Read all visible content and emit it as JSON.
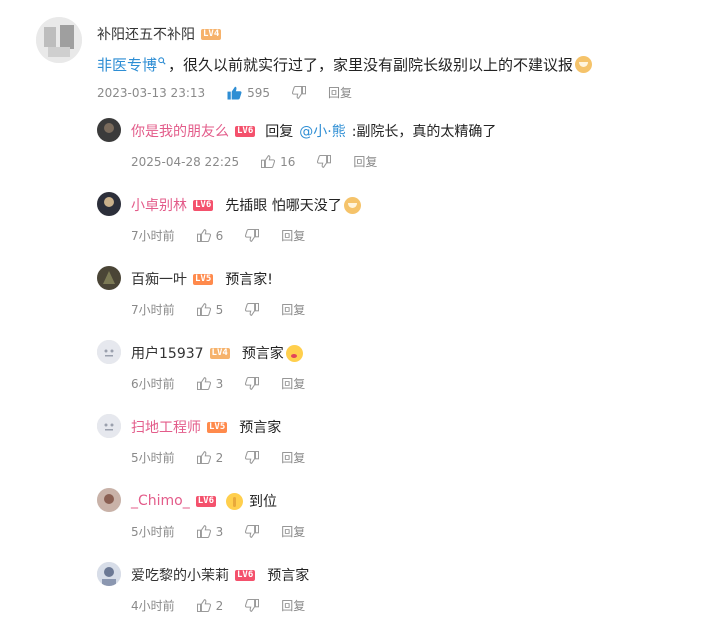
{
  "main": {
    "username": "补阳还五不补阳",
    "level": "LV4",
    "topic_link": "非医专博",
    "text": "，很久以前就实行过了，家里没有副院长级别以上的不建议报",
    "timestamp": "2023-03-13 23:13",
    "likes": "595",
    "reply_label": "回复"
  },
  "replies": [
    {
      "username": "你是我的朋友么",
      "level": "LV6",
      "prefix": "回复 ",
      "mention": "@小·熊",
      "text": ":副院长，真的太精确了",
      "timestamp": "2025-04-28 22:25",
      "likes": "16",
      "reply_label": "回复"
    },
    {
      "username": "小卓别林",
      "level": "LV6",
      "text": "先插眼 怕哪天没了",
      "timestamp": "7小时前",
      "likes": "6",
      "reply_label": "回复"
    },
    {
      "username": "百痴一叶",
      "level": "LV5",
      "text": "预言家!",
      "timestamp": "7小时前",
      "likes": "5",
      "reply_label": "回复"
    },
    {
      "username": "用户15937",
      "level": "LV4",
      "text": "预言家",
      "timestamp": "6小时前",
      "likes": "3",
      "reply_label": "回复"
    },
    {
      "username": "扫地工程师",
      "level": "LV5",
      "text": "预言家",
      "timestamp": "5小时前",
      "likes": "2",
      "reply_label": "回复"
    },
    {
      "username": "_Chimo_",
      "level": "LV6",
      "text": "到位",
      "timestamp": "5小时前",
      "likes": "3",
      "reply_label": "回复"
    },
    {
      "username": "爱吃黎的小茉莉",
      "level": "LV6",
      "text": "预言家",
      "timestamp": "4小时前",
      "likes": "2",
      "reply_label": "回复"
    }
  ],
  "colors": {
    "link": "#2e8ed4",
    "pink_username": "#e35c8a",
    "like_active": "#2e8ed4",
    "meta_gray": "#8a8a8a"
  },
  "icons": {
    "like": "thumbs-up-icon",
    "dislike": "thumbs-down-icon",
    "topic": "search-icon"
  }
}
